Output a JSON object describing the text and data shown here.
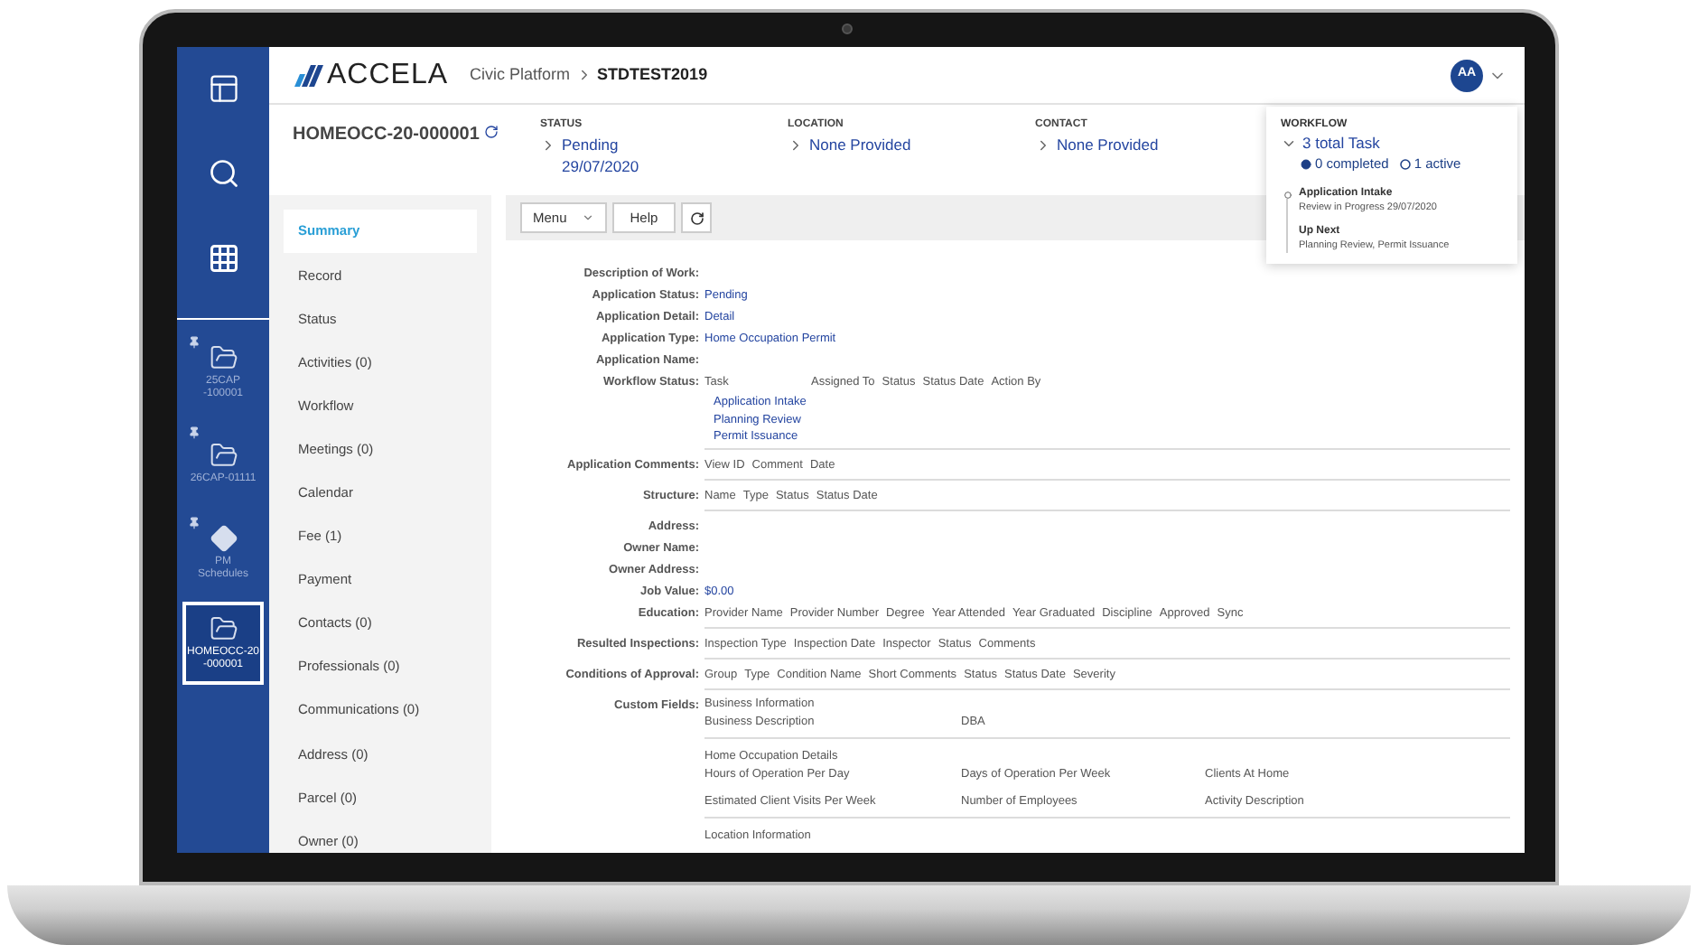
{
  "rail": [
    {
      "kind": "folder",
      "lines": [
        "25CAP",
        "-100001"
      ],
      "pinned": true,
      "selected": false
    },
    {
      "kind": "folder",
      "lines": [
        "26CAP-01111"
      ],
      "pinned": true,
      "selected": false
    },
    {
      "kind": "diamond",
      "lines": [
        "PM",
        "Schedules"
      ],
      "pinned": true,
      "selected": false
    },
    {
      "kind": "folder",
      "lines": [
        "HOMEOCC-20",
        "-000001"
      ],
      "pinned": false,
      "selected": true
    }
  ],
  "header": {
    "logo": "ACCELA",
    "app": "Civic Platform",
    "context": "STDTEST2019",
    "avatar": "AA"
  },
  "record": {
    "id": "HOMEOCC-20-000001",
    "summary": [
      {
        "heading": "STATUS",
        "lines": [
          "Pending",
          "29/07/2020"
        ]
      },
      {
        "heading": "LOCATION",
        "lines": [
          "None Provided"
        ]
      },
      {
        "heading": "CONTACT",
        "lines": [
          "None Provided"
        ]
      }
    ]
  },
  "workflow": {
    "heading": "WORKFLOW",
    "total": "3 total Task",
    "completed": "0 completed",
    "active": "1 active",
    "current_title": "Application Intake",
    "current_detail": "Review in Progress 29/07/2020",
    "next_title": "Up Next",
    "next_detail": "Planning Review, Permit Issuance"
  },
  "record_nav": [
    {
      "label": "Summary",
      "selected": true
    },
    {
      "label": "Record",
      "selected": false
    },
    {
      "label": "Status",
      "selected": false
    },
    {
      "label": "Activities (0)",
      "selected": false
    },
    {
      "label": "Workflow",
      "selected": false
    },
    {
      "label": "Meetings (0)",
      "selected": false
    },
    {
      "label": "Calendar",
      "selected": false
    },
    {
      "label": "Fee (1)",
      "selected": false
    },
    {
      "label": "Payment",
      "selected": false
    },
    {
      "label": "Contacts (0)",
      "selected": false
    },
    {
      "label": "Professionals (0)",
      "selected": false
    },
    {
      "label": "Communications (0)",
      "selected": false
    },
    {
      "label": "Address (0)",
      "selected": false
    },
    {
      "label": "Parcel (0)",
      "selected": false
    },
    {
      "label": "Owner (0)",
      "selected": false
    }
  ],
  "toolbar": {
    "menu": "Menu",
    "help": "Help"
  },
  "fields": [
    {
      "kind": "plain",
      "label": "Description of Work:"
    },
    {
      "kind": "value",
      "label": "Application Status:",
      "value": "Pending"
    },
    {
      "kind": "value",
      "label": "Application Detail:",
      "value": "Detail"
    },
    {
      "kind": "value",
      "label": "Application Type:",
      "value": "Home Occupation Permit"
    },
    {
      "kind": "plain",
      "label": "Application Name:"
    },
    {
      "kind": "table",
      "label": "Workflow Status:",
      "columns": [
        "Task",
        "Assigned To",
        "Status",
        "Status Date",
        "Action By"
      ],
      "rows": [
        "Application Intake",
        "Planning Review",
        "Permit Issuance"
      ]
    },
    {
      "kind": "table",
      "label": "Application Comments:",
      "columns": [
        "View ID",
        "Comment",
        "Date"
      ]
    },
    {
      "kind": "table",
      "label": "Structure:",
      "columns": [
        "Name",
        "Type",
        "Status",
        "Status Date"
      ]
    },
    {
      "kind": "plain",
      "label": "Address:"
    },
    {
      "kind": "plain",
      "label": "Owner Name:"
    },
    {
      "kind": "plain",
      "label": "Owner Address:"
    },
    {
      "kind": "value",
      "label": "Job Value:",
      "value": "$0.00"
    },
    {
      "kind": "table",
      "label": "Education:",
      "columns": [
        "Provider Name",
        "Provider Number",
        "Degree",
        "Year Attended",
        "Year Graduated",
        "Discipline",
        "Approved",
        "Sync"
      ]
    },
    {
      "kind": "table",
      "label": "Resulted Inspections:",
      "columns": [
        "Inspection Type",
        "Inspection Date",
        "Inspector",
        "Status",
        "Comments"
      ]
    },
    {
      "kind": "table",
      "label": "Conditions of Approval:",
      "columns": [
        "Group",
        "Type",
        "Condition Name",
        "Short Comments",
        "Status",
        "Status Date",
        "Severity"
      ]
    },
    {
      "kind": "custom",
      "label": "Custom Fields:",
      "groups": [
        {
          "title": "Business Information",
          "fields": [
            "Business Description",
            "DBA"
          ]
        },
        {
          "title": "Home Occupation Details",
          "fields": [
            "Hours of Operation Per Day",
            "Days of Operation Per Week",
            "Clients At Home",
            "Estimated Client Visits Per Week",
            "Number of Employees",
            "Activity Description"
          ]
        },
        {
          "title": "Location Information"
        }
      ]
    }
  ]
}
